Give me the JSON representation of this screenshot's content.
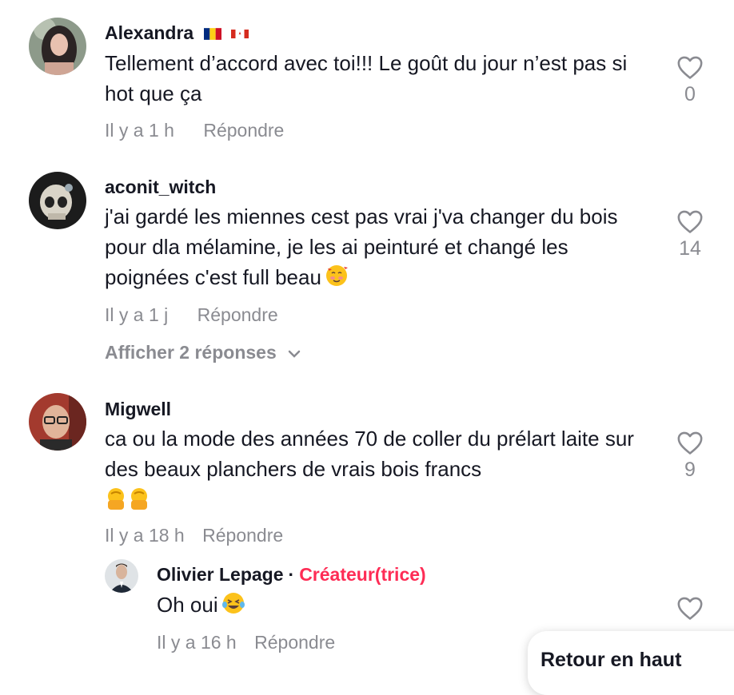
{
  "comments": [
    {
      "username": "Alexandra",
      "flags": [
        "romania-flag",
        "canada-flag"
      ],
      "text": "Tellement d’accord avec toi!!! Le goût du jour n’est pas si hot que ça",
      "time": "Il y a 1 h",
      "reply_label": "Répondre",
      "likes": "0"
    },
    {
      "username": "aconit_witch",
      "text": "j'ai gardé les miennes cest pas vrai j'va changer du bois pour dla mélamine, je les ai peinturé et changé les poignées c'est full beau",
      "emoji": "smiling-face-with-hearts",
      "time": "Il y a 1 j",
      "reply_label": "Répondre",
      "likes": "14",
      "view_replies": "Afficher 2 réponses"
    },
    {
      "username": "Migwell",
      "text": "ca ou la mode des années 70 de coller du prélart laite sur des beaux planchers de vrais bois francs",
      "emoji": "facepalm",
      "time": "Il y a 18 h",
      "reply_label": "Répondre",
      "likes": "9"
    }
  ],
  "reply": {
    "username": "Olivier Lepage",
    "separator": "·",
    "badge": "Créateur(trice)",
    "text": "Oh oui",
    "emoji": "laughing-tears",
    "time": "Il y a 16 h",
    "reply_label": "Répondre"
  },
  "back_to_top": "Retour en haut",
  "colors": {
    "text": "#161823",
    "muted": "#8a8b91",
    "creator": "#fe2c55"
  }
}
